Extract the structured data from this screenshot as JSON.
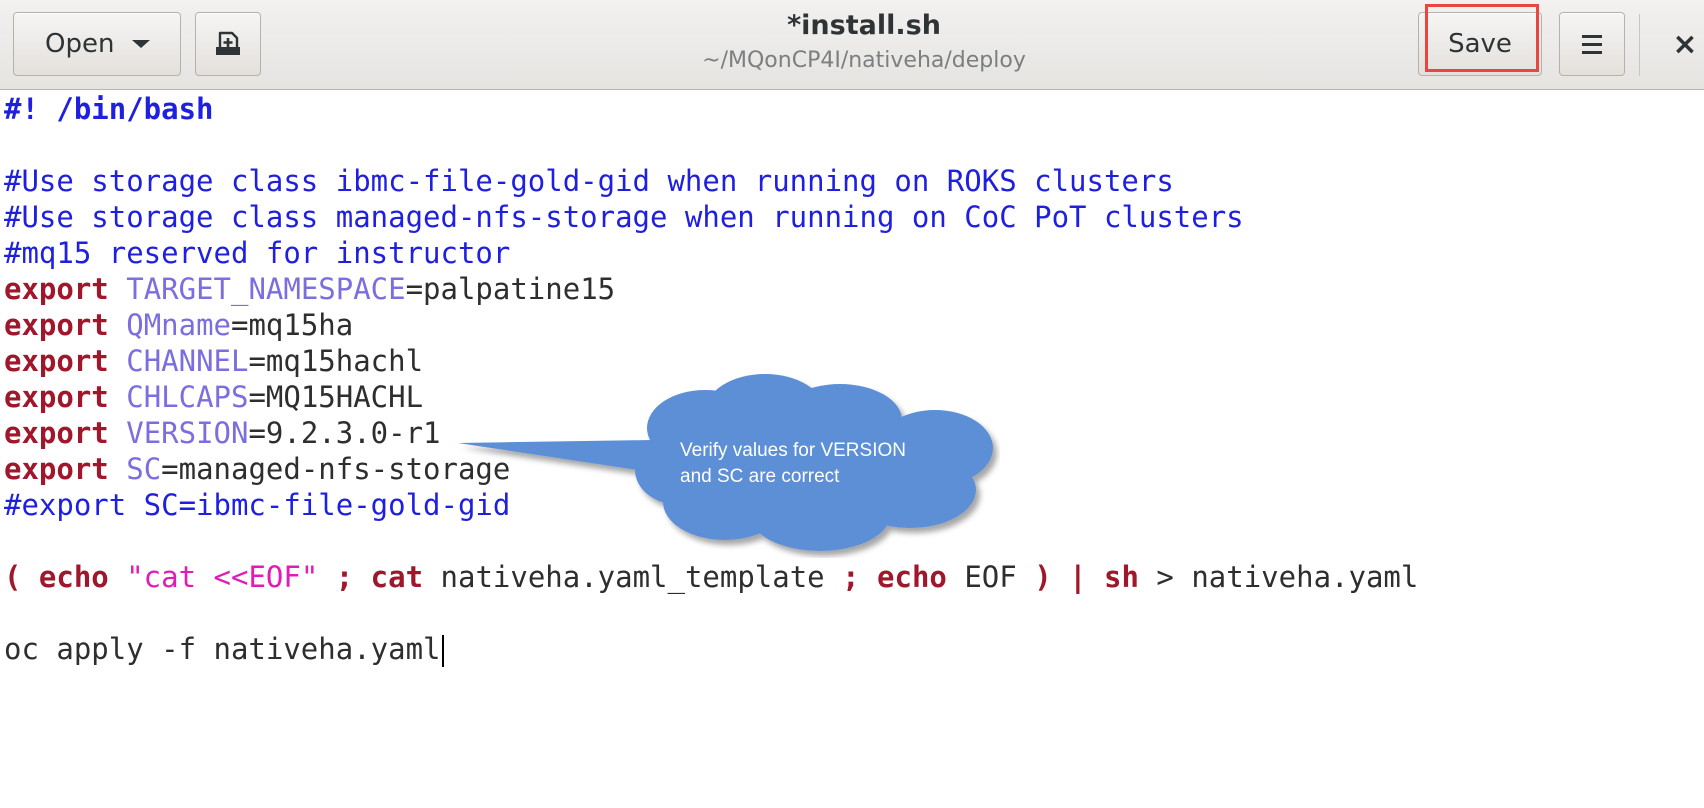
{
  "header": {
    "open_label": "Open",
    "title": "*install.sh",
    "subtitle": "~/MQonCP4I/nativeha/deploy",
    "save_label": "Save",
    "close_glyph": "×",
    "icons": {
      "open_dropdown": "chevron-down-icon",
      "new_document": "new-document-icon",
      "menu": "hamburger-menu-icon",
      "close": "close-icon"
    }
  },
  "editor": {
    "lines": {
      "l1": "#! /bin/bash",
      "l3": "#Use storage class ibmc-file-gold-gid when running on ROKS clusters",
      "l4": "#Use storage class managed-nfs-storage when running on CoC PoT clusters",
      "l5": "#mq15 reserved for instructor",
      "l6": {
        "kw": "export",
        "var": "TARGET_NAMESPACE",
        "val": "=palpatine15"
      },
      "l7": {
        "kw": "export",
        "var": "QMname",
        "val": "=mq15ha"
      },
      "l8": {
        "kw": "export",
        "var": "CHANNEL",
        "val": "=mq15hachl"
      },
      "l9": {
        "kw": "export",
        "var": "CHLCAPS",
        "val": "=MQ15HACHL"
      },
      "l10": {
        "kw": "export",
        "var": "VERSION",
        "val": "=9.2.3.0-r1"
      },
      "l11": {
        "kw": "export",
        "var": "SC",
        "val": "=managed-nfs-storage"
      },
      "l12": "#export SC=ibmc-file-gold-gid",
      "l14": {
        "p1": "( ",
        "echo1": "echo",
        "str": " \"cat <<EOF\"",
        "semi1": " ; ",
        "cat": "cat",
        "file": " nativeha.yaml_template ",
        "semi2": ";",
        "echo2": " echo",
        "eof": " EOF ",
        "close_pipe": ") |",
        "sh": " sh",
        "redir": " > nativeha.yaml"
      },
      "l16": "oc apply -f nativeha.yaml"
    }
  },
  "callout": {
    "line1": "Verify values for VERSION",
    "line2": "and SC are correct",
    "fill": "#5b8fd6"
  },
  "colors": {
    "comment": "#1f1fe0",
    "keyword": "#a0172c",
    "variable": "#7b6fe0",
    "string": "#e21bb8",
    "highlight": "#e8463f"
  }
}
